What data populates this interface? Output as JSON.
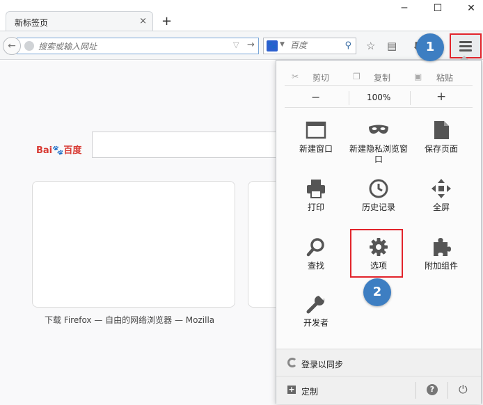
{
  "window": {
    "tab_title": "新标签页",
    "tab_close": "×",
    "new_tab": "+",
    "minimize": "─",
    "maximize": "☐",
    "close": "✕"
  },
  "navbar": {
    "url_placeholder": "搜索或输入网址",
    "search_placeholder": "百度",
    "search_engine_icon": "baidu-paw-icon",
    "search_engine_glyph": "🐾"
  },
  "badges": {
    "step1": "1",
    "step2": "2"
  },
  "newtab": {
    "baidu_logo_text": "Bai",
    "baidu_logo_text2": "百度",
    "tile_caption": "下载 Firefox — 自由的网络浏览器 — Mozilla"
  },
  "menu": {
    "edit": {
      "cut": "剪切",
      "copy": "复制",
      "paste": "粘贴"
    },
    "zoom": {
      "minus": "−",
      "value": "100%",
      "plus": "+"
    },
    "items": [
      {
        "label": "新建窗口",
        "icon": "new-window-icon"
      },
      {
        "label": "新建隐私浏览窗口",
        "icon": "private-mask-icon"
      },
      {
        "label": "保存页面",
        "icon": "save-page-icon"
      },
      {
        "label": "打印",
        "icon": "printer-icon"
      },
      {
        "label": "历史记录",
        "icon": "history-clock-icon"
      },
      {
        "label": "全屏",
        "icon": "fullscreen-icon"
      },
      {
        "label": "查找",
        "icon": "magnifier-icon"
      },
      {
        "label": "选项",
        "icon": "gear-icon"
      },
      {
        "label": "附加组件",
        "icon": "puzzle-icon"
      },
      {
        "label": "开发者",
        "icon": "wrench-icon"
      }
    ],
    "sync_label": "登录以同步",
    "customize_label": "定制",
    "help_glyph": "?",
    "power_glyph": "⏻"
  },
  "colors": {
    "highlight": "#e2242b",
    "badge": "#3d7ec2"
  }
}
